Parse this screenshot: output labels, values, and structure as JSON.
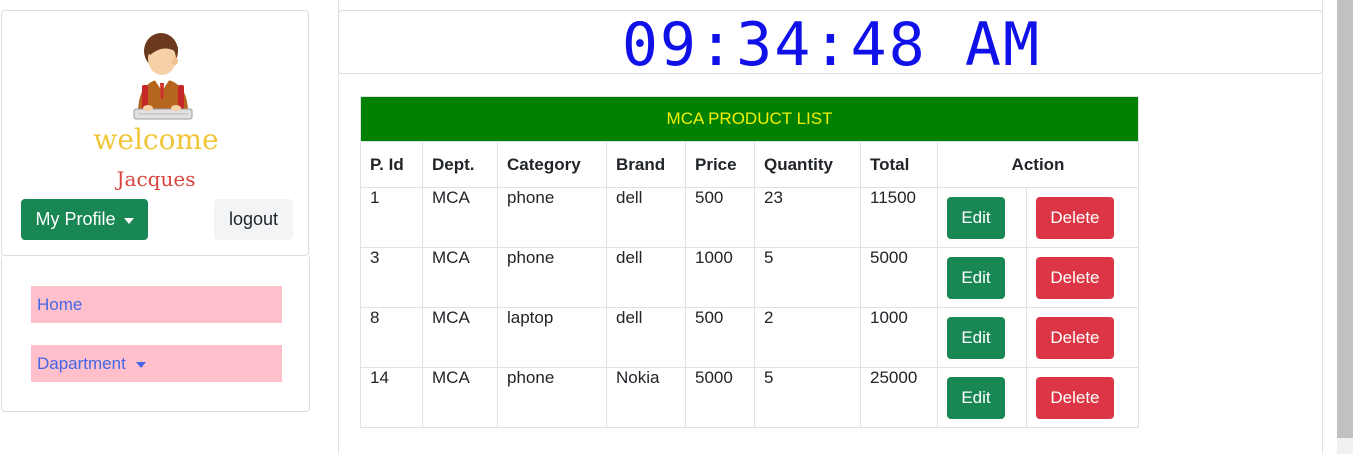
{
  "profile": {
    "welcome": "welcome",
    "username": "Jacques",
    "my_profile_label": "My Profile",
    "logout_label": "logout"
  },
  "nav": {
    "items": [
      {
        "label": "Home",
        "has_dropdown": false
      },
      {
        "label": "Dapartment",
        "has_dropdown": true
      }
    ]
  },
  "clock": {
    "time": "09:34:48 AM",
    "color": "#1010e8"
  },
  "table": {
    "title": "MCA PRODUCT LIST",
    "headers": [
      "P. Id",
      "Dept.",
      "Category",
      "Brand",
      "Price",
      "Quantity",
      "Total",
      "Action"
    ],
    "rows": [
      [
        "1",
        "MCA",
        "phone",
        "dell",
        "500",
        "23",
        "11500"
      ],
      [
        "3",
        "MCA",
        "phone",
        "dell",
        "1000",
        "5",
        "5000"
      ],
      [
        "8",
        "MCA",
        "laptop",
        "dell",
        "500",
        "2",
        "1000"
      ],
      [
        "14",
        "MCA",
        "phone",
        "Nokia",
        "5000",
        "5",
        "25000"
      ]
    ],
    "edit_label": "Edit",
    "delete_label": "Delete"
  },
  "colors": {
    "title_bar": "#008000",
    "title_text": "#f2f000",
    "edit_button": "#198754",
    "delete_button": "#dc3545",
    "nav_background": "#ffc0cb",
    "nav_text": "#4566e6",
    "welcome_text": "#f2c538",
    "username_text": "#d9443c"
  }
}
